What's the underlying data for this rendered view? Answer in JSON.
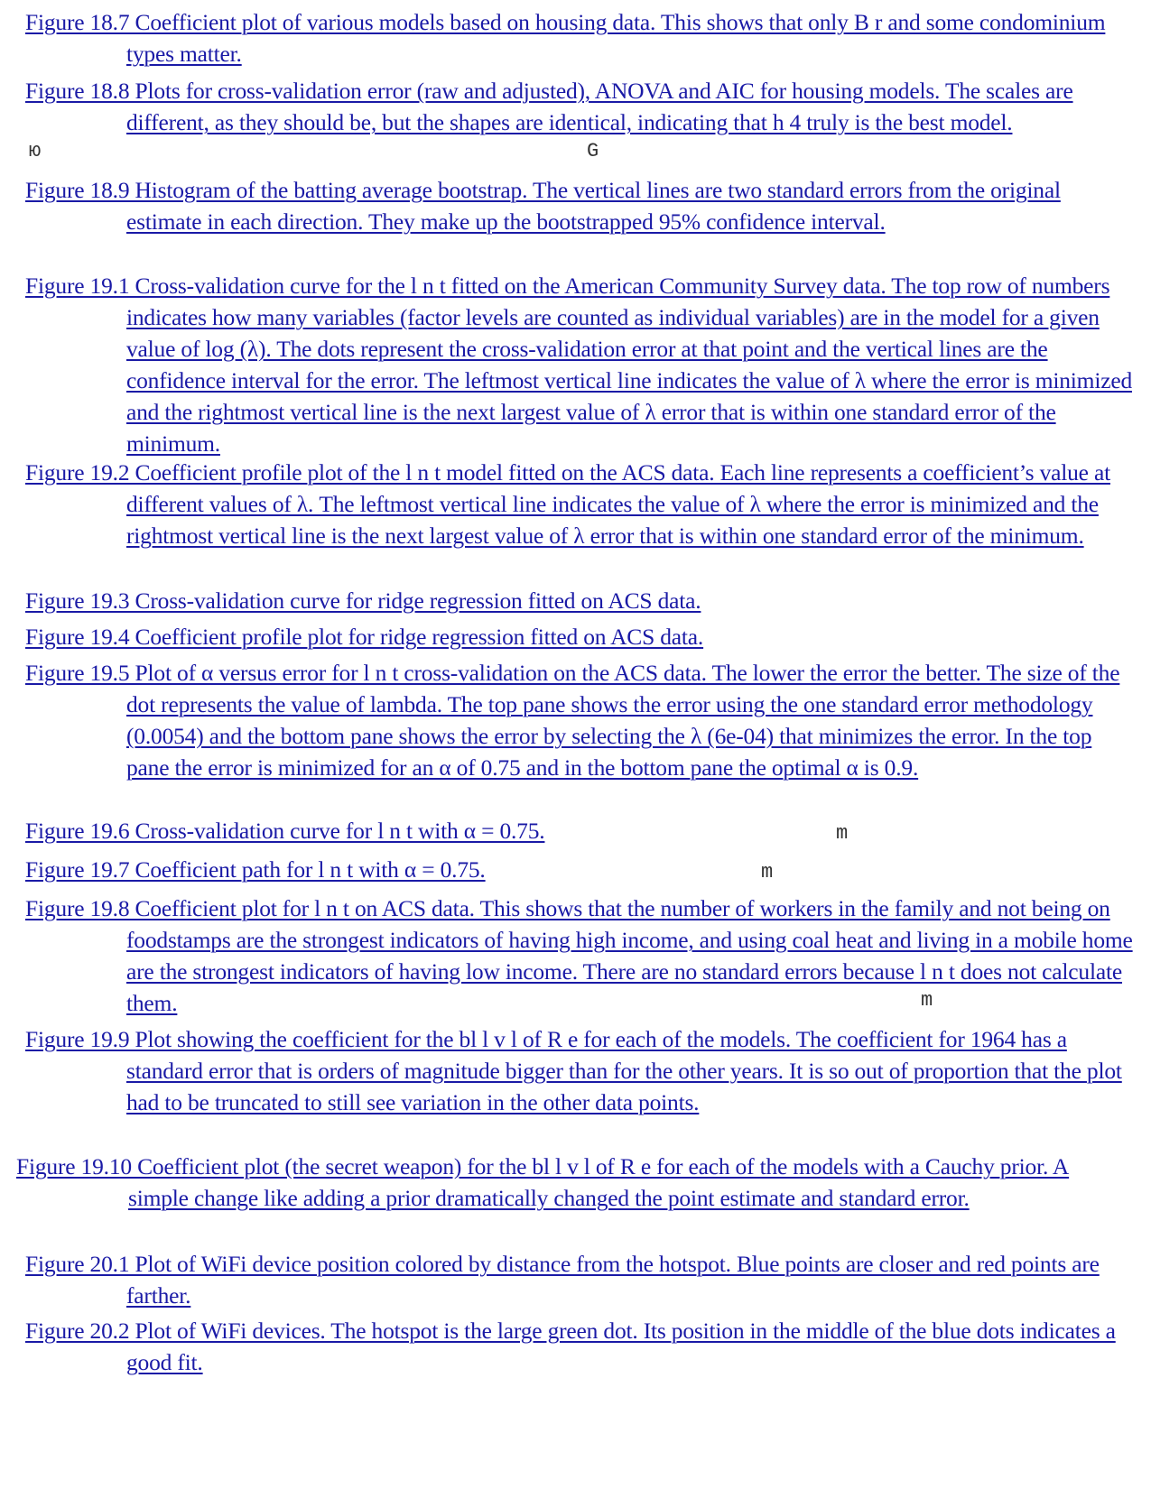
{
  "entries": [
    {
      "text": "Figure 18.7 Coefficient plot of various models based on housing data. This shows that only B r and some condominium types matter."
    },
    {
      "text": "Figure 18.8 Plots for cross-validation error (raw and adjusted), ANOVA and AIC for housing models. The scales are different, as they should be, but the shapes are identical, indicating that h 4 truly is the best model."
    },
    {
      "text": "Figure 18.9 Histogram of the batting average bootstrap. The vertical lines are two standard errors from the original estimate in each direction. They make up the bootstrapped 95% confidence interval."
    },
    {
      "text": "Figure 19.1 Cross-validation curve for the l n t fitted on the American Community Survey data. The top row of numbers indicates how many variables (factor levels are counted as individual variables) are in the model for a given value of log (λ). The dots represent the cross-validation error at that point and the vertical lines are the confidence interval for the error. The leftmost vertical line indicates the value of λ where the error is minimized and the rightmost vertical line is the next largest value of λ error that is within one standard error of the minimum."
    },
    {
      "text": "Figure 19.2 Coefficient profile plot of the l n t model fitted on the ACS data. Each line represents a coefficient’s value at different values of λ. The leftmost vertical line indicates the value of λ where the error is minimized and the rightmost vertical line is the next largest value of λ error that is within one standard error of the minimum."
    },
    {
      "text": "Figure 19.3 Cross-validation curve for ridge regression fitted on ACS data."
    },
    {
      "text": "Figure 19.4 Coefficient profile plot for ridge regression fitted on ACS data."
    },
    {
      "text": "Figure 19.5 Plot of α versus error for l n t cross-validation on the ACS data. The lower the error the better. The size of the dot represents the value of lambda. The top pane shows the error using the one standard error methodology (0.0054) and the bottom pane shows the error by selecting the λ (6e-04) that minimizes the error. In the top pane the error is minimized for an α of 0.75 and in the bottom pane the optimal α is 0.9."
    },
    {
      "text": "Figure 19.6 Cross-validation curve for l n t with α = 0.75."
    },
    {
      "text": "Figure 19.7 Coefficient path for l n t with α = 0.75."
    },
    {
      "text": "Figure 19.8 Coefficient plot for l n t on ACS data. This shows that the number of workers in the family and not being on foodstamps are the strongest indicators of having high income, and using coal heat and living in a mobile home are the strongest indicators of having low income. There are no standard errors because l n t does not calculate them."
    },
    {
      "text": "Figure 19.9 Plot showing the coefficient for the bl l v l of R e for each of the models. The coefficient for 1964 has a standard error that is orders of magnitude bigger than for the other years. It is so out of proportion that the plot had to be truncated to still see variation in the other data points."
    },
    {
      "text": "Figure 19.10 Coefficient plot (the secret weapon) for the bl l v l of R e for each of the models with a Cauchy prior. A simple change like adding a prior dramatically changed the point estimate and standard error."
    },
    {
      "text": "Figure 20.1 Plot of WiFi device position colored by distance from the hotspot. Blue points are closer and red points are farther."
    },
    {
      "text": "Figure 20.2 Plot of WiFi devices. The hotspot is the large green dot. Its position in the middle of the blue dots indicates a good fit."
    }
  ],
  "stray_glyphs": [
    "ю",
    "G",
    "m",
    "m",
    "m"
  ]
}
